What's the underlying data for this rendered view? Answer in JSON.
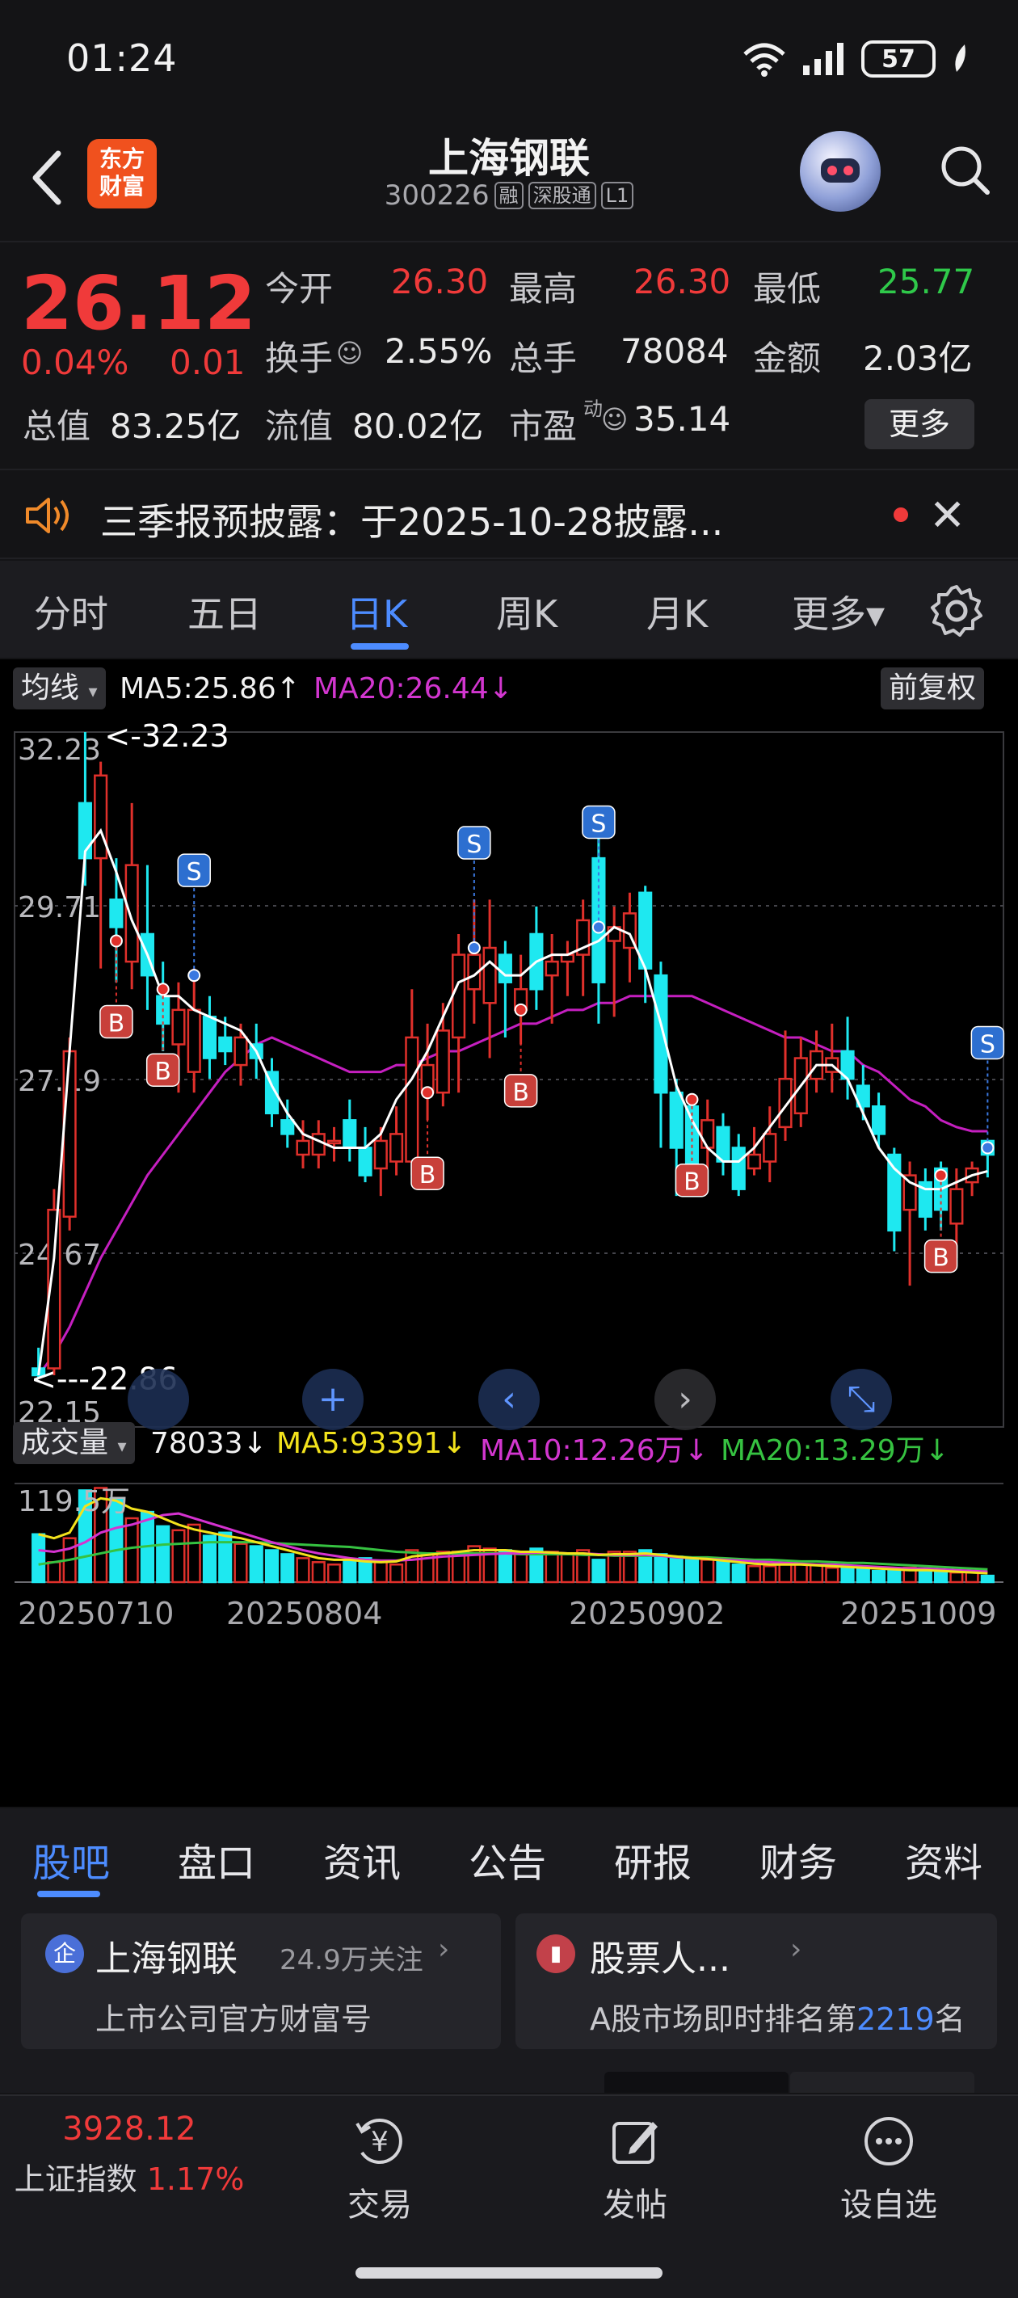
{
  "status_bar": {
    "time": "01:24",
    "battery": "57"
  },
  "header": {
    "app_logo_text": [
      "东方",
      "财富"
    ],
    "stock_name": "上海钢联",
    "stock_code": "300226",
    "tags": [
      "融",
      "深股通",
      "L1"
    ]
  },
  "quote": {
    "price": "26.12",
    "change_pct": "0.04%",
    "change": "0.01",
    "fields": [
      {
        "label": "今开",
        "value": "26.30",
        "color": "#f03a3a"
      },
      {
        "label": "最高",
        "value": "26.30",
        "color": "#f03a3a"
      },
      {
        "label": "最低",
        "value": "25.77",
        "color": "#2fc94a"
      },
      {
        "label": "换手",
        "value": "2.55%",
        "color": "#eaeaea"
      },
      {
        "label": "总手",
        "value": "78084",
        "color": "#eaeaea"
      },
      {
        "label": "金额",
        "value": "2.03亿",
        "color": "#eaeaea"
      },
      {
        "label": "总值",
        "value": "83.25亿",
        "color": "#eaeaea"
      },
      {
        "label": "流值",
        "value": "80.02亿",
        "color": "#eaeaea"
      },
      {
        "label": "市盈",
        "value": "35.14",
        "color": "#eaeaea"
      }
    ],
    "pe_superscript": "动",
    "more_button": "更多"
  },
  "notice": {
    "text": "三季报预披露：于2025-10-28披露..."
  },
  "period_tabs": [
    {
      "label": "分时",
      "active": false
    },
    {
      "label": "五日",
      "active": false
    },
    {
      "label": "日K",
      "active": true
    },
    {
      "label": "周K",
      "active": false
    },
    {
      "label": "月K",
      "active": false
    },
    {
      "label": "更多▾",
      "active": false
    }
  ],
  "kline": {
    "indicator_selector": "均线",
    "ma5_label": "MA5:25.86",
    "ma5_arrow": "↑",
    "ma20_label": "MA20:26.44",
    "ma20_arrow": "↓",
    "adjust_button": "前复权",
    "y_ticks": [
      "32.23",
      "29.71",
      "27.19",
      "24.67",
      "22.15"
    ],
    "max_marker": "<-32.23",
    "min_marker": "<---22.86",
    "colors": {
      "up": "#e0302b",
      "down": "#1ee8f0",
      "ma5": "#ffffff",
      "ma20": "#c51fc0",
      "ma10": "#d532d0",
      "vol_ma20": "#36c241",
      "vol_ma5": "#f2e21c"
    }
  },
  "volume": {
    "selector": "成交量",
    "value": "78033",
    "value_arrow": "↓",
    "ma5": "MA5:93391",
    "ma5_arrow": "↓",
    "ma10": "MA10:12.26万",
    "ma10_arrow": "↓",
    "ma20": "MA20:13.29万",
    "ma20_arrow": "↓",
    "max_tick": "119.5万",
    "x_dates": [
      "20250710",
      "20250804",
      "20250902",
      "20251009"
    ]
  },
  "chart_data": {
    "type": "candlestick",
    "ylim": [
      22.15,
      32.23
    ],
    "candles": [
      {
        "o": 23.0,
        "c": 22.9,
        "h": 23.3,
        "l": 22.86,
        "up": false
      },
      {
        "o": 23.0,
        "c": 25.3,
        "h": 25.6,
        "l": 22.9,
        "up": true
      },
      {
        "o": 25.2,
        "c": 27.6,
        "h": 27.8,
        "l": 25.0,
        "up": true
      },
      {
        "o": 30.4,
        "c": 31.2,
        "h": 32.23,
        "l": 30.0,
        "up": false
      },
      {
        "o": 30.4,
        "c": 31.6,
        "h": 31.8,
        "l": 28.8,
        "up": true
      },
      {
        "o": 29.8,
        "c": 29.4,
        "h": 30.4,
        "l": 28.6,
        "up": false
      },
      {
        "o": 28.9,
        "c": 30.3,
        "h": 31.2,
        "l": 28.5,
        "up": true
      },
      {
        "o": 29.3,
        "c": 28.7,
        "h": 30.3,
        "l": 28.2,
        "up": false
      },
      {
        "o": 28.4,
        "c": 28.0,
        "h": 28.9,
        "l": 27.6,
        "up": false
      },
      {
        "o": 27.7,
        "c": 28.2,
        "h": 28.6,
        "l": 27.0,
        "up": true
      },
      {
        "o": 27.3,
        "c": 28.2,
        "h": 28.8,
        "l": 27.0,
        "up": true
      },
      {
        "o": 27.5,
        "c": 28.1,
        "h": 28.4,
        "l": 27.2,
        "up": false
      },
      {
        "o": 27.8,
        "c": 27.6,
        "h": 28.1,
        "l": 27.4,
        "up": false
      },
      {
        "o": 27.4,
        "c": 27.8,
        "h": 28.0,
        "l": 27.1,
        "up": true
      },
      {
        "o": 27.7,
        "c": 27.5,
        "h": 28.0,
        "l": 27.2,
        "up": false
      },
      {
        "o": 27.3,
        "c": 26.7,
        "h": 27.5,
        "l": 26.5,
        "up": false
      },
      {
        "o": 26.6,
        "c": 26.4,
        "h": 26.9,
        "l": 26.2,
        "up": false
      },
      {
        "o": 26.3,
        "c": 26.1,
        "h": 26.6,
        "l": 25.9,
        "up": true
      },
      {
        "o": 26.1,
        "c": 26.4,
        "h": 26.6,
        "l": 25.9,
        "up": true
      },
      {
        "o": 26.3,
        "c": 26.3,
        "h": 26.5,
        "l": 26.0,
        "up": true
      },
      {
        "o": 26.6,
        "c": 26.2,
        "h": 26.9,
        "l": 26.0,
        "up": false
      },
      {
        "o": 26.2,
        "c": 25.8,
        "h": 26.5,
        "l": 25.7,
        "up": false
      },
      {
        "o": 25.9,
        "c": 26.3,
        "h": 26.5,
        "l": 25.5,
        "up": true
      },
      {
        "o": 26.0,
        "c": 26.4,
        "h": 26.8,
        "l": 25.8,
        "up": true
      },
      {
        "o": 26.0,
        "c": 27.8,
        "h": 28.5,
        "l": 25.8,
        "up": true
      },
      {
        "o": 27.4,
        "c": 27.0,
        "h": 28.0,
        "l": 26.6,
        "up": true
      },
      {
        "o": 27.0,
        "c": 27.9,
        "h": 28.3,
        "l": 26.8,
        "up": true
      },
      {
        "o": 27.8,
        "c": 29.0,
        "h": 29.3,
        "l": 27.0,
        "up": true
      },
      {
        "o": 29.0,
        "c": 28.5,
        "h": 29.8,
        "l": 28.0,
        "up": true
      },
      {
        "o": 28.3,
        "c": 29.1,
        "h": 29.8,
        "l": 27.5,
        "up": true
      },
      {
        "o": 28.6,
        "c": 29.0,
        "h": 29.2,
        "l": 27.8,
        "up": false
      },
      {
        "o": 28.5,
        "c": 28.2,
        "h": 29.0,
        "l": 27.7,
        "up": true
      },
      {
        "o": 28.5,
        "c": 29.3,
        "h": 29.7,
        "l": 28.2,
        "up": false
      },
      {
        "o": 28.7,
        "c": 28.9,
        "h": 29.3,
        "l": 28.0,
        "up": true
      },
      {
        "o": 28.9,
        "c": 29.0,
        "h": 29.2,
        "l": 28.4,
        "up": true
      },
      {
        "o": 29.0,
        "c": 29.5,
        "h": 29.8,
        "l": 28.4,
        "up": true
      },
      {
        "o": 30.4,
        "c": 28.6,
        "h": 30.7,
        "l": 28.0,
        "up": false
      },
      {
        "o": 29.2,
        "c": 29.4,
        "h": 29.7,
        "l": 28.1,
        "up": true
      },
      {
        "o": 29.6,
        "c": 29.1,
        "h": 29.9,
        "l": 28.6,
        "up": true
      },
      {
        "o": 29.9,
        "c": 28.8,
        "h": 30.0,
        "l": 28.3,
        "up": false
      },
      {
        "o": 28.7,
        "c": 27.0,
        "h": 28.9,
        "l": 26.2,
        "up": false
      },
      {
        "o": 27.0,
        "c": 26.2,
        "h": 27.2,
        "l": 25.5,
        "up": false
      },
      {
        "o": 26.8,
        "c": 25.8,
        "h": 26.9,
        "l": 25.5,
        "up": false
      },
      {
        "o": 26.2,
        "c": 26.6,
        "h": 26.9,
        "l": 25.9,
        "up": true
      },
      {
        "o": 26.5,
        "c": 26.0,
        "h": 26.7,
        "l": 25.8,
        "up": false
      },
      {
        "o": 26.2,
        "c": 25.6,
        "h": 26.4,
        "l": 25.5,
        "up": false
      },
      {
        "o": 25.9,
        "c": 26.1,
        "h": 26.5,
        "l": 25.8,
        "up": true
      },
      {
        "o": 26.0,
        "c": 26.4,
        "h": 26.8,
        "l": 25.7,
        "up": true
      },
      {
        "o": 27.2,
        "c": 26.5,
        "h": 27.9,
        "l": 26.3,
        "up": true
      },
      {
        "o": 26.7,
        "c": 27.5,
        "h": 27.8,
        "l": 26.5,
        "up": true
      },
      {
        "o": 27.2,
        "c": 27.6,
        "h": 27.9,
        "l": 27.0,
        "up": true
      },
      {
        "o": 27.5,
        "c": 27.3,
        "h": 28.0,
        "l": 27.0,
        "up": true
      },
      {
        "o": 27.6,
        "c": 27.2,
        "h": 28.1,
        "l": 26.9,
        "up": false
      },
      {
        "o": 27.1,
        "c": 26.8,
        "h": 27.4,
        "l": 26.6,
        "up": false
      },
      {
        "o": 26.8,
        "c": 26.4,
        "h": 27.0,
        "l": 26.2,
        "up": false
      },
      {
        "o": 26.1,
        "c": 25.0,
        "h": 26.2,
        "l": 24.7,
        "up": false
      },
      {
        "o": 25.3,
        "c": 25.8,
        "h": 26.0,
        "l": 24.2,
        "up": true
      },
      {
        "o": 25.7,
        "c": 25.2,
        "h": 25.9,
        "l": 25.0,
        "up": false
      },
      {
        "o": 25.3,
        "c": 25.9,
        "h": 26.0,
        "l": 25.0,
        "up": false
      },
      {
        "o": 25.1,
        "c": 25.6,
        "h": 25.9,
        "l": 24.6,
        "up": true
      },
      {
        "o": 25.7,
        "c": 25.9,
        "h": 26.0,
        "l": 25.5,
        "up": true
      },
      {
        "o": 26.3,
        "c": 26.1,
        "h": 26.3,
        "l": 25.77,
        "up": false
      }
    ],
    "ma5": [
      22.9,
      24.6,
      27.6,
      30.5,
      30.8,
      30.2,
      29.5,
      29.0,
      28.4,
      28.4,
      28.2,
      28.1,
      28.0,
      27.9,
      27.6,
      27.1,
      26.7,
      26.4,
      26.3,
      26.2,
      26.2,
      26.2,
      26.4,
      26.9,
      27.2,
      27.6,
      28.1,
      28.6,
      28.7,
      28.9,
      28.7,
      28.7,
      28.9,
      29.0,
      29.0,
      29.1,
      29.2,
      29.4,
      29.3,
      28.8,
      28.0,
      27.1,
      26.6,
      26.2,
      26.0,
      26.0,
      26.2,
      26.5,
      26.8,
      27.1,
      27.4,
      27.4,
      27.2,
      26.7,
      26.2,
      25.9,
      25.7,
      25.6,
      25.6,
      25.7,
      25.8,
      25.86
    ],
    "ma20": [
      22.9,
      23.2,
      23.6,
      24.1,
      24.6,
      25.0,
      25.4,
      25.8,
      26.1,
      26.4,
      26.7,
      27.0,
      27.3,
      27.5,
      27.7,
      27.8,
      27.7,
      27.6,
      27.5,
      27.4,
      27.3,
      27.3,
      27.3,
      27.4,
      27.4,
      27.5,
      27.6,
      27.6,
      27.7,
      27.8,
      27.9,
      28.0,
      28.0,
      28.1,
      28.2,
      28.2,
      28.3,
      28.3,
      28.4,
      28.4,
      28.4,
      28.4,
      28.4,
      28.3,
      28.2,
      28.1,
      28.0,
      27.9,
      27.8,
      27.8,
      27.7,
      27.6,
      27.6,
      27.4,
      27.3,
      27.1,
      26.9,
      26.8,
      26.6,
      26.5,
      26.44,
      26.44
    ],
    "markers": [
      {
        "i": 5,
        "type": "B",
        "price": 29.2
      },
      {
        "i": 8,
        "type": "B",
        "price": 28.5
      },
      {
        "i": 10,
        "type": "S",
        "price": 28.7
      },
      {
        "i": 25,
        "type": "B",
        "price": 27.0
      },
      {
        "i": 28,
        "type": "S",
        "price": 29.1
      },
      {
        "i": 31,
        "type": "B",
        "price": 28.2
      },
      {
        "i": 36,
        "type": "S",
        "price": 29.4
      },
      {
        "i": 42,
        "type": "B",
        "price": 26.9
      },
      {
        "i": 58,
        "type": "B",
        "price": 25.8
      },
      {
        "i": 61,
        "type": "S",
        "price": 26.2
      }
    ],
    "volumes": [
      60,
      25,
      55,
      115,
      118,
      105,
      80,
      88,
      70,
      65,
      72,
      58,
      62,
      48,
      45,
      40,
      35,
      30,
      25,
      22,
      28,
      30,
      25,
      22,
      40,
      35,
      38,
      38,
      45,
      42,
      40,
      36,
      42,
      38,
      35,
      40,
      28,
      38,
      38,
      40,
      35,
      32,
      30,
      28,
      26,
      22,
      20,
      20,
      24,
      22,
      22,
      18,
      18,
      16,
      14,
      16,
      18,
      16,
      14,
      12,
      12,
      8
    ],
    "vol_ma5": [
      60,
      55,
      62,
      95,
      105,
      102,
      92,
      88,
      80,
      72,
      66,
      62,
      58,
      55,
      50,
      45,
      40,
      35,
      30,
      28,
      28,
      26,
      25,
      26,
      32,
      34,
      36,
      38,
      40,
      40,
      40,
      38,
      38,
      37,
      36,
      36,
      34,
      35,
      35,
      36,
      34,
      32,
      30,
      29,
      27,
      25,
      23,
      22,
      22,
      22,
      21,
      20,
      19,
      18,
      17,
      16,
      15,
      15,
      14,
      13,
      12,
      11
    ],
    "vol_ma10": [
      40,
      38,
      42,
      50,
      62,
      68,
      72,
      78,
      84,
      86,
      80,
      74,
      68,
      62,
      56,
      50,
      45,
      40,
      36,
      33,
      30,
      28,
      27,
      27,
      28,
      30,
      32,
      33,
      34,
      35,
      36,
      36,
      37,
      37,
      36,
      36,
      35,
      34,
      34,
      34,
      33,
      31,
      30,
      29,
      28,
      27,
      26,
      25,
      24,
      23,
      22,
      22,
      21,
      20,
      19,
      18,
      17,
      17,
      16,
      15,
      14,
      13
    ],
    "vol_ma20": [
      22,
      25,
      28,
      32,
      36,
      40,
      43,
      45,
      47,
      48,
      49,
      50,
      50,
      50,
      50,
      49,
      48,
      47,
      46,
      45,
      44,
      42,
      40,
      38,
      37,
      36,
      36,
      36,
      36,
      36,
      36,
      35,
      35,
      35,
      35,
      34,
      34,
      33,
      33,
      33,
      33,
      32,
      31,
      31,
      30,
      29,
      28,
      28,
      27,
      26,
      26,
      25,
      24,
      24,
      23,
      22,
      21,
      20,
      19,
      18,
      17,
      16
    ],
    "vol_max": 119.5
  },
  "bottom_tabs": [
    {
      "label": "股吧",
      "active": true
    },
    {
      "label": "盘口",
      "active": false
    },
    {
      "label": "资讯",
      "active": false
    },
    {
      "label": "公告",
      "active": false
    },
    {
      "label": "研报",
      "active": false
    },
    {
      "label": "财务",
      "active": false
    },
    {
      "label": "资料",
      "active": false
    }
  ],
  "cards": {
    "left_title": "上海钢联",
    "left_follow": "24.9万关注",
    "left_sub": "上市公司官方财富号",
    "right_title": "股票人...",
    "right_sub_prefix": "A股市场即时排名第",
    "right_rank": "2219",
    "right_sub_suffix": "名"
  },
  "bottom_nav": {
    "index_value": "3928.12",
    "index_name": "上证指数",
    "index_pct": "1.17%",
    "items": [
      "交易",
      "发帖",
      "设自选"
    ]
  }
}
